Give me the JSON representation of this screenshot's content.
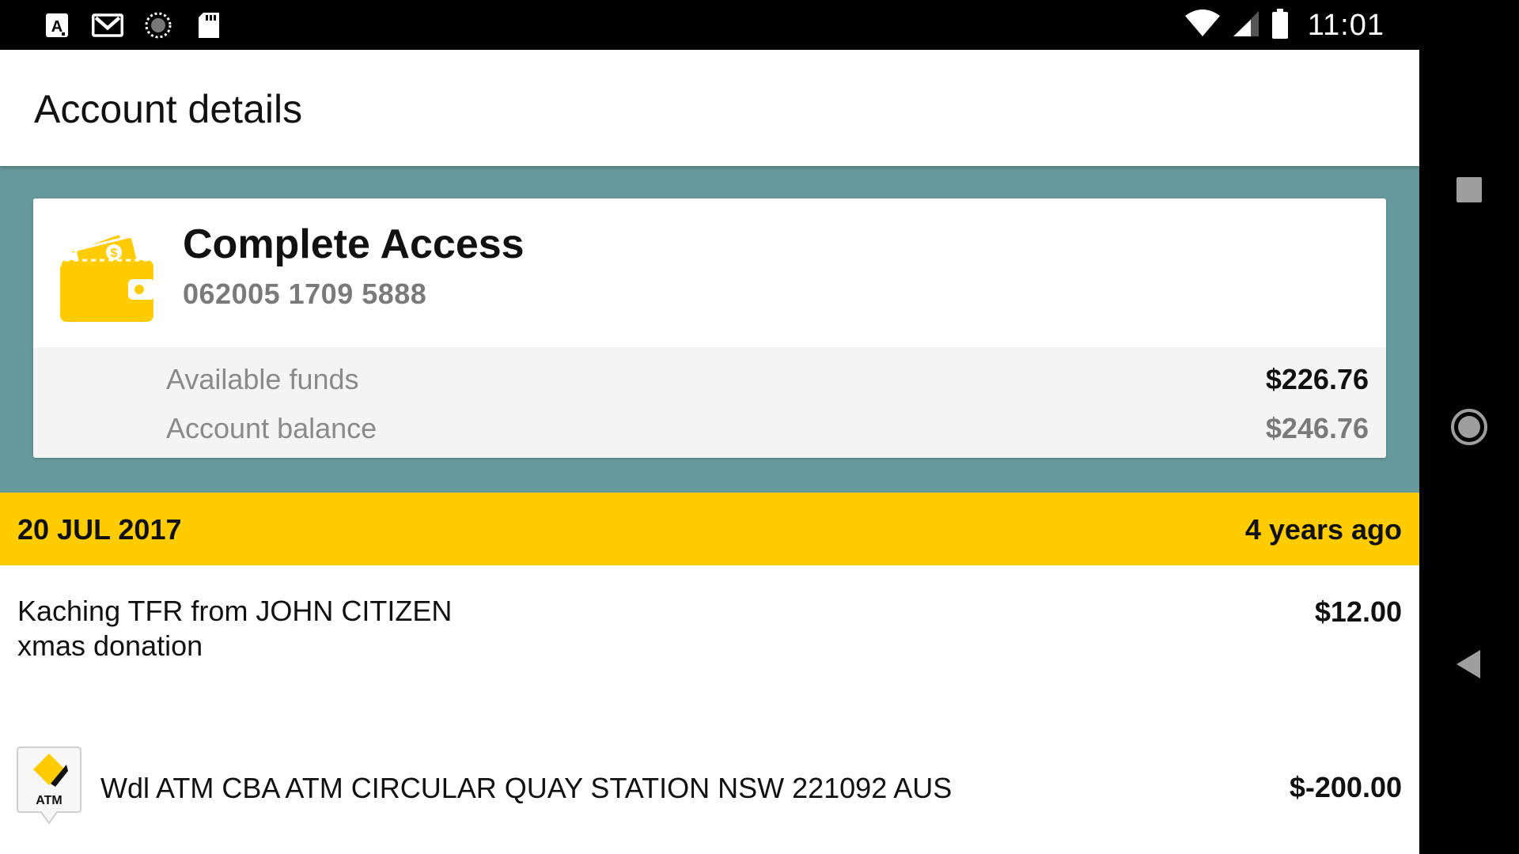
{
  "status_bar": {
    "time": "11:01",
    "left_icons": [
      "accessibility-app-icon",
      "gmail-icon",
      "sync-icon",
      "sd-card-icon"
    ],
    "right_icons": [
      "wifi-icon",
      "cell-signal-icon",
      "battery-icon"
    ]
  },
  "toolbar": {
    "title": "Account details"
  },
  "account": {
    "name": "Complete Access",
    "number": "062005 1709 5888",
    "available_label": "Available funds",
    "available_value": "$226.76",
    "balance_label": "Account balance",
    "balance_value": "$246.76"
  },
  "date_header": {
    "date": "20 JUL 2017",
    "relative": "4 years ago"
  },
  "transactions": [
    {
      "line1": "Kaching TFR from JOHN CITIZEN",
      "line2": "xmas donation",
      "amount": "$12.00"
    },
    {
      "icon": "atm-icon",
      "icon_text": "ATM",
      "line1": "Wdl ATM CBA ATM CIRCULAR QUAY STATION NSW 221092 AUS",
      "amount": "$-200.00"
    }
  ],
  "nav_bar": {
    "buttons": [
      "recents-button",
      "home-button",
      "back-button"
    ]
  },
  "colors": {
    "teal": "#65999A",
    "yellow": "#FFCC00",
    "wallet": "#FFCC00",
    "muted_text": "#7a7a7a"
  }
}
